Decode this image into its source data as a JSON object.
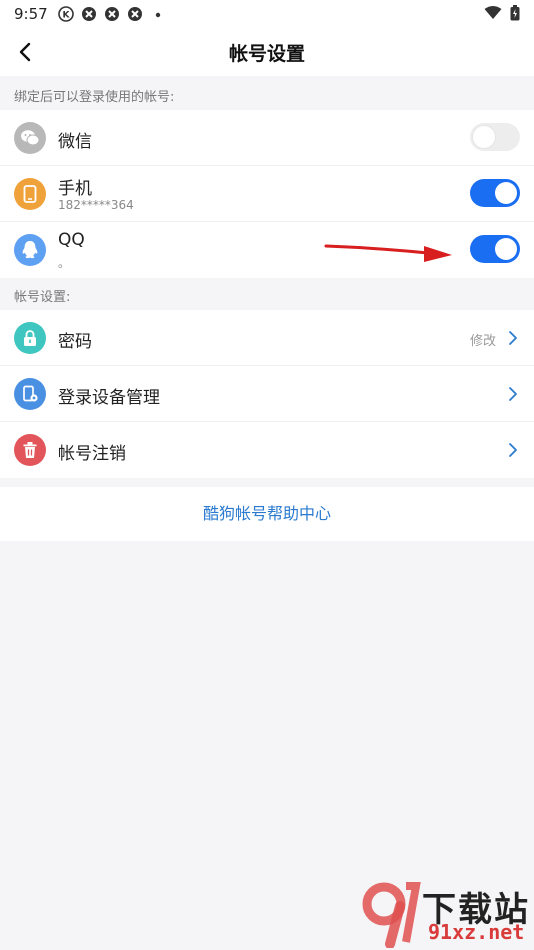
{
  "status_bar": {
    "time": "9:57",
    "icons": [
      "k-badge-icon",
      "app-icon",
      "app-icon",
      "app-icon",
      "dot-icon"
    ],
    "right_icons": [
      "wifi-icon",
      "battery-icon"
    ]
  },
  "header": {
    "title": "帐号设置",
    "back_icon": "chevron-left-icon"
  },
  "bind_section": {
    "label": "绑定后可以登录使用的帐号:",
    "items": [
      {
        "label": "微信",
        "sub": "",
        "icon": "wechat-icon",
        "icon_color": "#b8b8b8",
        "toggle_on": false
      },
      {
        "label": "手机",
        "sub": "182*****364",
        "icon": "phone-icon",
        "icon_color": "#f0a23a",
        "toggle_on": true
      },
      {
        "label": "QQ",
        "sub": "。",
        "icon": "qq-icon",
        "icon_color": "#5ea0f2",
        "toggle_on": true
      }
    ]
  },
  "account_section": {
    "label": "帐号设置:",
    "items": [
      {
        "label": "密码",
        "right_text": "修改",
        "icon": "lock-icon",
        "icon_color": "#3fc6c0"
      },
      {
        "label": "登录设备管理",
        "right_text": "",
        "icon": "device-icon",
        "icon_color": "#4a90e2"
      },
      {
        "label": "帐号注销",
        "right_text": "",
        "icon": "trash-icon",
        "icon_color": "#e2555a"
      }
    ]
  },
  "help_link": "酷狗帐号帮助中心",
  "colors": {
    "accent": "#1a6ef2",
    "link": "#2a7ad0",
    "arrow": "#d81e1e"
  },
  "watermark": {
    "line1": "下载站",
    "line2": "91xz.net"
  }
}
